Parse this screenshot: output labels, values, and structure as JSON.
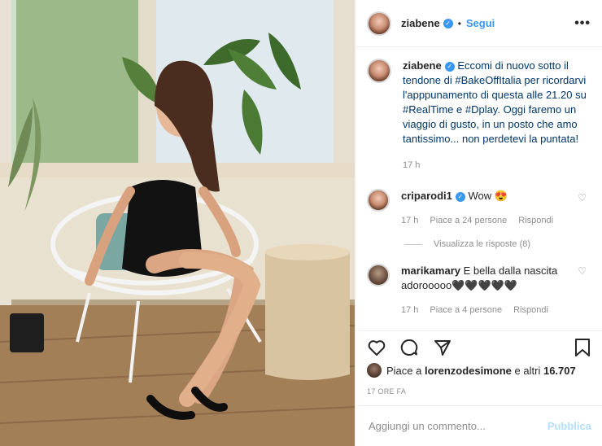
{
  "post": {
    "username": "ziabene",
    "separator": "•",
    "follow_label": "Segui",
    "more_label": "•••"
  },
  "caption": {
    "username": "ziabene",
    "text_1": "Eccomi di nuovo sotto il tendone di ",
    "tag_bakeoff": "#BakeOffItalia",
    "text_2": " per ricordarvi l'apppunamento di questa alle 21.20 su ",
    "tag_realtime": "#RealTime",
    "text_3": " e ",
    "tag_dplay": "#Dplay",
    "text_4": ". Oggi faremo un viaggio di gusto, in un posto che amo tantissimo... non perdetevi la puntata!",
    "time": "17 h"
  },
  "comments": [
    {
      "username": "criparodi1",
      "text": "Wow 😍",
      "time": "17 h",
      "likes": "Piace a 24 persone",
      "reply": "Rispondi",
      "view_replies": "Visualizza le risposte (8)"
    },
    {
      "username": "marikamary",
      "text": "E bella dalla nascita adorooooo🖤🖤🖤🖤🖤",
      "time": "17 h",
      "likes": "Piace a 4 persone",
      "reply": "Rispondi"
    }
  ],
  "engagement": {
    "liked_by_prefix": "Piace a ",
    "liked_by_user": "lorenzodesimone",
    "liked_by_suffix": " e altri ",
    "liked_by_count": "16.707",
    "posted_ago": "17 ORE FA"
  },
  "composer": {
    "placeholder": "Aggiungi un commento...",
    "publish_label": "Pubblica"
  },
  "colors": {
    "link": "#3897f0",
    "hashtag": "#00376b",
    "muted": "#8e8e8e",
    "publish_disabled": "#b2dffc"
  },
  "icons": [
    "heart-icon",
    "comment-icon",
    "share-icon",
    "bookmark-icon",
    "verified-icon",
    "more-options-icon"
  ]
}
